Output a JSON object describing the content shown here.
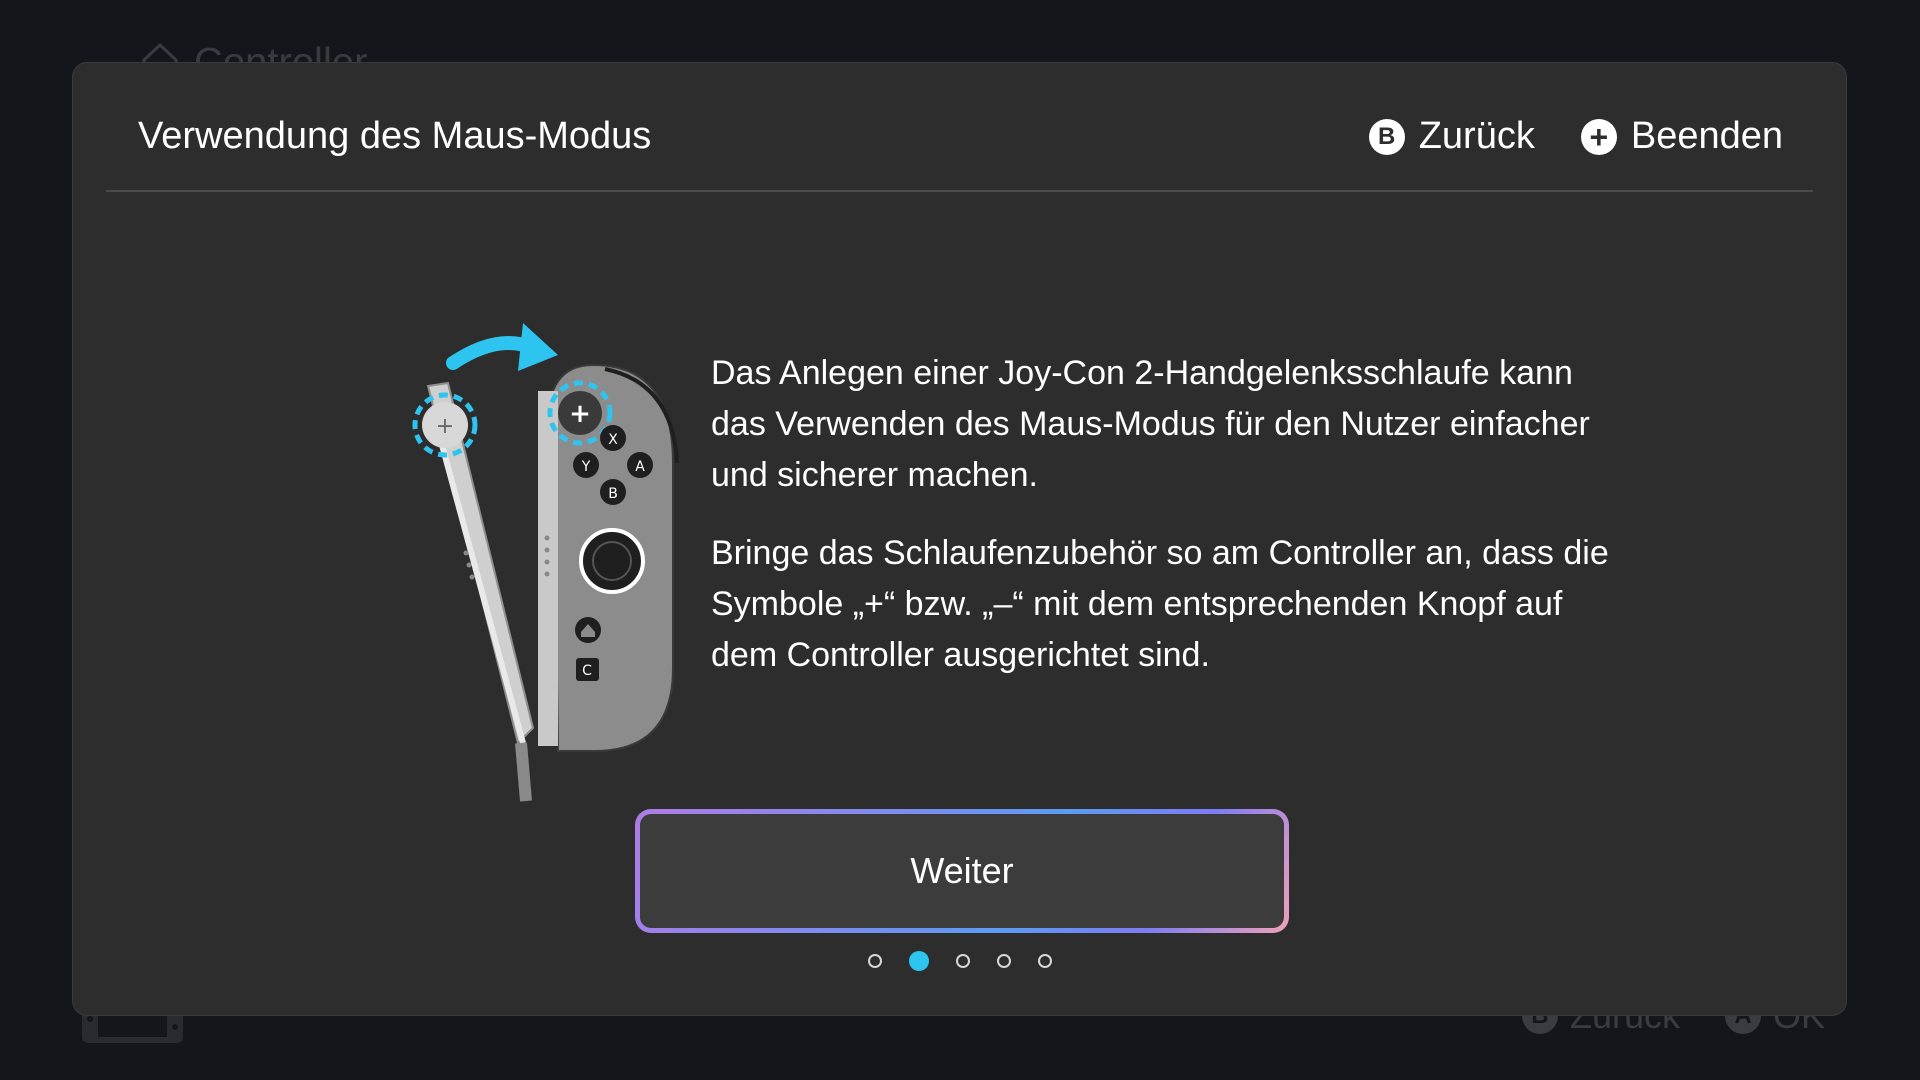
{
  "background": {
    "title": "Controller",
    "footer": [
      {
        "glyph": "B",
        "label": "Zurück"
      },
      {
        "glyph": "A",
        "label": "OK"
      }
    ]
  },
  "dialog": {
    "title": "Verwendung des Maus-Modus",
    "actions": [
      {
        "glyph": "B",
        "label": "Zurück"
      },
      {
        "glyph": "+",
        "label": "Beenden"
      }
    ],
    "paragraphs": [
      "Das Anlegen einer Joy-Con 2-Handgelenksschlaufe kann das Verwenden des Maus-Modus für den Nutzer einfacher und sicherer machen.",
      "Bringe das Schlaufenzubehör so am Controller an, dass die Symbole „+“ bzw. „–“ mit dem entsprechenden Knopf auf dem Controller ausgerichtet sind."
    ],
    "button_label": "Weiter",
    "pager": {
      "total": 5,
      "current": 2
    }
  },
  "illustration": {
    "controller_buttons": [
      "X",
      "Y",
      "A",
      "B",
      "C"
    ],
    "accent_color": "#2ec4f0"
  },
  "colors": {
    "modal_bg": "#2d2d2e",
    "page_bg": "#15161b",
    "accent": "#2ec4f0"
  }
}
